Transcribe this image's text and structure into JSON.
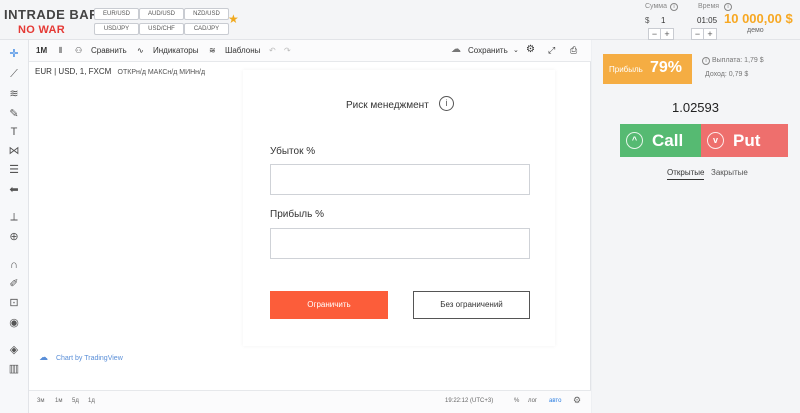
{
  "header": {
    "logo": "INTRADE BAR",
    "banner": "NO WAR",
    "pairs": [
      "EUR/USD",
      "AUD/USD",
      "NZD/USD",
      "USD/JPY",
      "USD/CHF",
      "CAD/JPY"
    ],
    "amount_label": "Сумма",
    "amount_value": "1",
    "time_label": "Время",
    "time_value": "01:05",
    "currency": "$",
    "minus": "−",
    "plus": "+",
    "balance": "10 000,00 $",
    "account_type": "демо",
    "info_glyph": "i"
  },
  "toolbar": {
    "interval": "1M",
    "compare": "Сравнить",
    "indicators": "Индикаторы",
    "templates": "Шаблоны",
    "save": "Сохранить"
  },
  "chart": {
    "legend_symbol": "EUR | USD, 1, FXCM",
    "legend_ohlc": "ОТКРн/д  МАКСн/д  МИНн/д",
    "watermark": "Chart by TradingView",
    "ranges": [
      "3м",
      "1м",
      "5д",
      "1д"
    ],
    "clock": "19:22:12 (UTC+3)",
    "percent": "%",
    "log": "лог",
    "auto": "авто"
  },
  "modal": {
    "title": "Риск менеджмент",
    "info_glyph": "i",
    "loss_label": "Убыток %",
    "loss_value": "",
    "profit_label": "Прибыль %",
    "profit_value": "",
    "limit_button": "Ограничить",
    "no_limit_button": "Без ограничений"
  },
  "trade": {
    "profit_label": "Прибыль",
    "profit_percent": "79%",
    "payout": "Выплата: 1,79 $",
    "income": "Доход: 0,79 $",
    "price": "1.02593",
    "call": "Call",
    "put": "Put",
    "tab_open": "Открытые",
    "tab_closed": "Закрытые"
  },
  "colors": {
    "accent_orange": "#f7a823",
    "call_green": "#56ba72",
    "put_red": "#ee6f6d",
    "limit_button": "#fc5d3a",
    "no_war_red": "#e53935"
  },
  "icons": [
    "crosshair-icon",
    "trendline-icon",
    "fib-icon",
    "brush-icon",
    "text-icon",
    "pattern-icon",
    "prediction-icon",
    "arrow-left-icon",
    "ruler-icon",
    "zoom-icon",
    "magnet-icon",
    "lock-drawing-icon",
    "lock-icon",
    "eye-icon",
    "layers-icon",
    "trash-icon",
    "star-icon",
    "cloud-icon",
    "settings-icon",
    "fullscreen-icon",
    "camera-icon",
    "undo-icon",
    "redo-icon"
  ]
}
